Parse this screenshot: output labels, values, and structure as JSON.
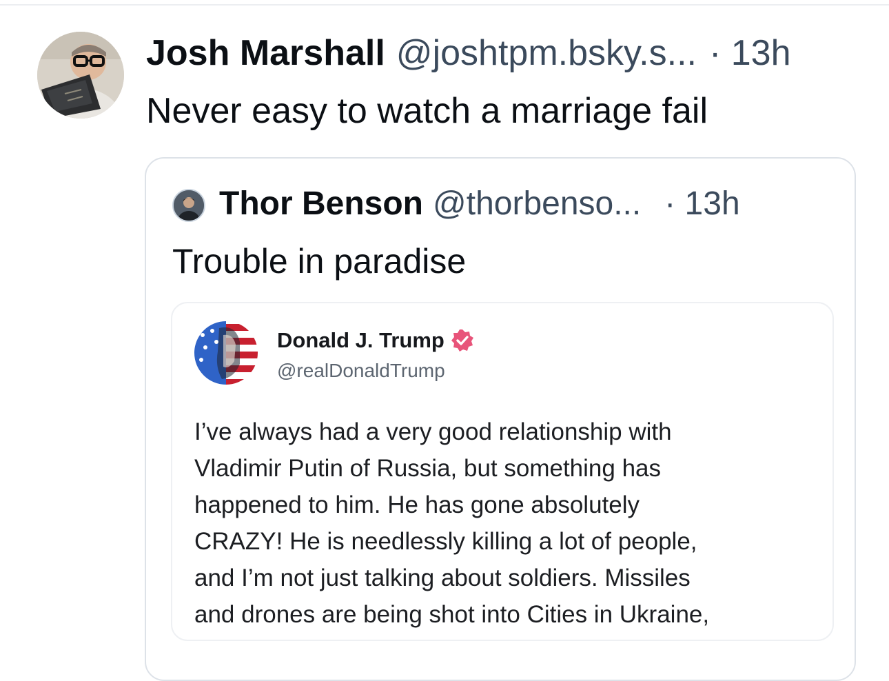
{
  "post": {
    "author_name": "Josh Marshall",
    "author_handle": "@joshtpm.bsky.s...",
    "time": "· 13h",
    "text": "Never easy to watch a marriage fail"
  },
  "quote": {
    "author_name": "Thor Benson",
    "author_handle": "@thorbenso...",
    "time": "· 13h",
    "text": "Trouble in paradise"
  },
  "embed": {
    "author_name": "Donald J. Trump",
    "author_handle": "@realDonaldTrump",
    "verified_icon": "verified-badge-icon",
    "body_lines": [
      "I’ve always had a very good relationship with",
      "Vladimir Putin of Russia, but something has",
      "happened to him. He has gone absolutely",
      "CRAZY! He is needlessly killing a lot of people,",
      "and I’m not just talking about soldiers. Missiles",
      "and drones are being shot into Cities in Ukraine,"
    ]
  },
  "colors": {
    "text": "#0b0f14",
    "muted": "#3b4a5c",
    "card_border": "#dde2e8",
    "verified": "#e8547a"
  }
}
